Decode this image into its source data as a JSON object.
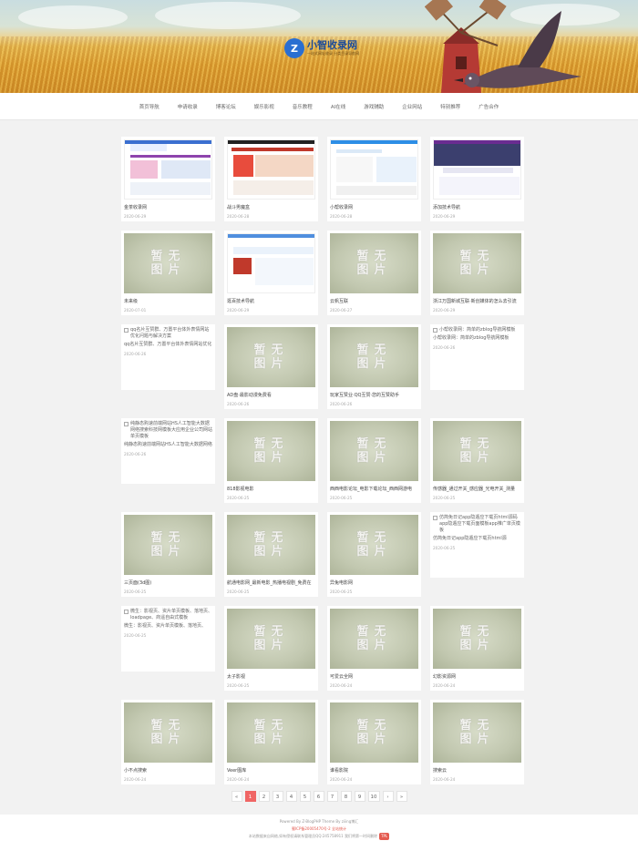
{
  "header": {
    "logo_badge": "Z",
    "logo_title": "小智收录网",
    "logo_sub": "一站式网址收录 分类目录导航网"
  },
  "nav": [
    "首页导航",
    "申请收录",
    "博客论坛",
    "娱乐影视",
    "音乐教程",
    "AI在线",
    "游戏辅助",
    "企业网站",
    "特别推荐",
    "广告合作"
  ],
  "placeholder_text": [
    "暂无",
    "图片"
  ],
  "cards": [
    {
      "type": "shot",
      "variant": "a",
      "title": "金茶收录网",
      "date": "2020-06-29"
    },
    {
      "type": "shot",
      "variant": "b",
      "title": "战斗男魔盒",
      "date": "2020-06-28"
    },
    {
      "type": "shot",
      "variant": "c",
      "title": "小帮收录网",
      "date": "2020-06-28"
    },
    {
      "type": "shot",
      "variant": "d",
      "title": "添加技术导航",
      "date": "2020-06-29"
    },
    {
      "type": "none",
      "title": "未来级",
      "date": "2020-07-01"
    },
    {
      "type": "shot",
      "variant": "e",
      "title": "逛百技术导航",
      "date": "2020-06-29"
    },
    {
      "type": "none",
      "title": "云帆互联",
      "date": "2020-06-27"
    },
    {
      "type": "none",
      "title": "浙江万国新城互联·新创媒体的怎么去引流",
      "date": "2020-06-29"
    },
    {
      "type": "broken",
      "alt": "qq名片互赞群、万置平台体外表情网站优化问题与解决方案",
      "desc": "qq名片互赞群、万置平台体外表情网站优化",
      "date": "2020-06-26",
      "short": true
    },
    {
      "type": "none",
      "title": "AD盘·最影动漫免费看",
      "date": "2020-06-26"
    },
    {
      "type": "none",
      "title": "玩家互赞业·QQ互赞·您的互赞助手",
      "date": "2020-06-26"
    },
    {
      "type": "broken",
      "alt": "小帮收录网：简单的zblog导航网模板",
      "desc": "小帮收录网：简单的zblog导航网模板",
      "date": "2020-06-26",
      "short": true
    },
    {
      "type": "broken",
      "alt": "纯静态购速前端网站HS人工智能大数据网络搜索科技网模板大应用企业公司网站单页模板",
      "desc": "纯静态购速前端网站HS人工智能大数据网络",
      "date": "2020-06-26",
      "short": true
    },
    {
      "type": "none",
      "title": "818影视电影",
      "date": "2020-06-25"
    },
    {
      "type": "none",
      "title": "西西电影论坛_电影下载论坛_西西网游电",
      "date": "2020-06-25"
    },
    {
      "type": "none",
      "title": "传感器_通过开关_感应器_光电开关_测量",
      "date": "2020-06-25"
    },
    {
      "type": "none",
      "title": "三页面(3d图)",
      "date": "2020-06-25"
    },
    {
      "type": "none",
      "title": "航通电影网_最新电影_热播电视剧_免费在",
      "date": "2020-06-25"
    },
    {
      "type": "none",
      "title": "异兔电影网",
      "date": "2020-06-25"
    },
    {
      "type": "broken",
      "alt": "仿简免日记app隐遁应下载页html源码app隐遁应下载页面模板app推广单页模板",
      "desc": "仿简免日记app隐遁应下载页html源",
      "date": "2020-06-25",
      "short": true
    },
    {
      "type": "broken",
      "alt": "微生：影视页、资片单页模板、落地页、loadpage、商遥自由式模板",
      "desc": "微生：影视页、资片单页模板、落地页、",
      "date": "2020-06-25",
      "short": true
    },
    {
      "type": "none",
      "title": "太子影视",
      "date": "2020-06-25"
    },
    {
      "type": "none",
      "title": "可爱云全网",
      "date": "2020-06-24"
    },
    {
      "type": "none",
      "title": "幻影资源网",
      "date": "2020-06-24"
    },
    {
      "type": "none",
      "title": "小不点搜索",
      "date": "2020-06-24"
    },
    {
      "type": "none",
      "title": "Veer图库",
      "date": "2020-06-24"
    },
    {
      "type": "none",
      "title": "谁看影院",
      "date": "2020-06-24"
    },
    {
      "type": "none",
      "title": "搜索云",
      "date": "2020-06-24"
    }
  ],
  "pagination": [
    "«",
    "1",
    "2",
    "3",
    "4",
    "5",
    "6",
    "7",
    "8",
    "9",
    "10",
    "›",
    "»"
  ],
  "pagination_active": "1",
  "footer": {
    "line1": "Powered By Z-BlogPHP Theme By ziiing博汇",
    "line2": "蜀ICP备20005470号-2 全站统计",
    "line3": "本站数据来自网络,如有侵权请联系管理员QQ:245758911 我们将第一时间删除",
    "badge": "TPL"
  },
  "colors": {
    "accent": "#f06564",
    "link_red": "#e45a4f",
    "placeholder_bg": "#c2c8b0"
  }
}
